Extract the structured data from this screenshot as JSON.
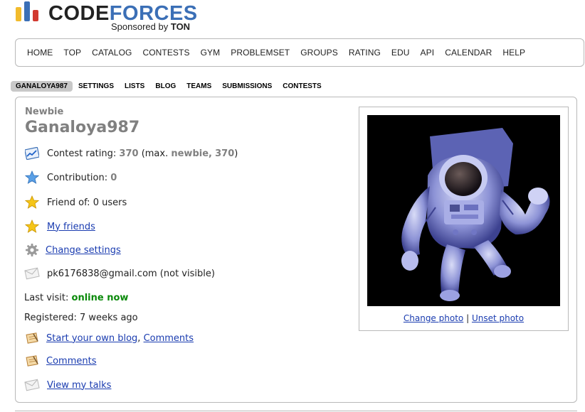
{
  "brand": {
    "code": "CODE",
    "forces": "FORCES",
    "sponsored_by": "Sponsored by",
    "sponsor": "TON",
    "colors": {
      "yellow": "#f2bb2c",
      "blue": "#3b6fb6",
      "red": "#d23a30"
    }
  },
  "menu": [
    "HOME",
    "TOP",
    "CATALOG",
    "CONTESTS",
    "GYM",
    "PROBLEMSET",
    "GROUPS",
    "RATING",
    "EDU",
    "API",
    "CALENDAR",
    "HELP"
  ],
  "subtabs": {
    "active": "GANALOYA987",
    "items": [
      "SETTINGS",
      "LISTS",
      "BLOG",
      "TEAMS",
      "SUBMISSIONS",
      "CONTESTS"
    ]
  },
  "profile": {
    "rank": "Newbie",
    "handle": "Ganaloya987",
    "rating_label": "Contest rating:",
    "rating_value": "370",
    "rating_max_open": "(max.",
    "rating_max_rank": "newbie,",
    "rating_max_value": "370",
    "rating_max_close": ")",
    "contribution_label": "Contribution:",
    "contribution_value": "0",
    "friend_of": "Friend of: 0 users",
    "my_friends": "My friends",
    "change_settings": "Change settings",
    "email": "pk6176838@gmail.com (not visible)",
    "last_visit_label": "Last visit:",
    "last_visit_value": "online now",
    "registered": "Registered: 7 weeks ago",
    "start_blog": "Start your own blog",
    "comma": ",",
    "comments_inline": "Comments",
    "comments": "Comments",
    "view_talks": "View my talks",
    "change_photo": "Change photo",
    "separator": "|",
    "unset_photo": "Unset photo"
  }
}
